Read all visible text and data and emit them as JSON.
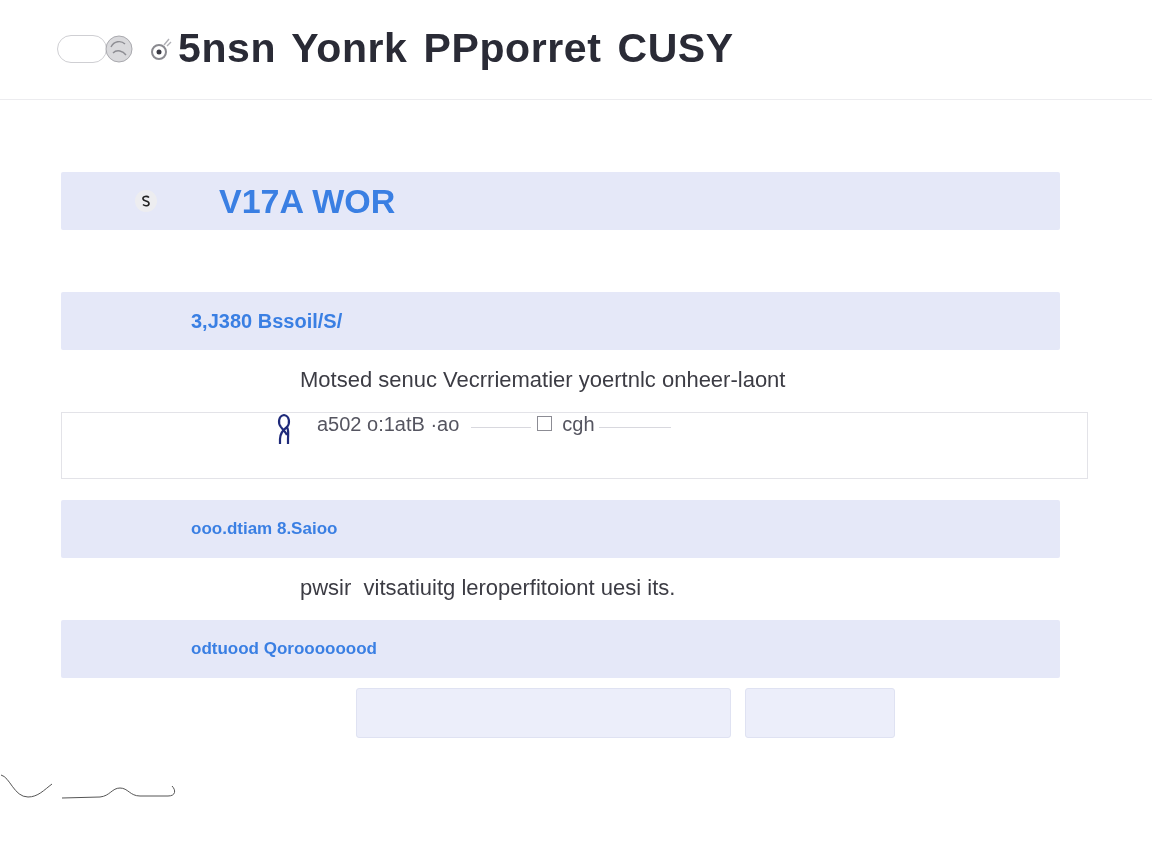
{
  "header": {
    "title": "5nsn Yonrk PPporret CUSY"
  },
  "sections": [
    {
      "kind": "main",
      "title": "V17A WOR"
    },
    {
      "kind": "sub",
      "title": "3,J380 Bssoil/S/",
      "description": "Motsed senuc Vecrriematier yoertnlc onheer-laont",
      "field": {
        "value": "a502 o:1atB ·ao",
        "checkbox": {
          "checked": false,
          "label": "cgh"
        }
      }
    },
    {
      "kind": "sub",
      "title": "ooo.dtiam 8.Saioo",
      "description": "pwsir  vitsatiuitg leroperfitoiont uesi its."
    },
    {
      "kind": "sub",
      "title": "odtuood Qoroooooood"
    }
  ],
  "buttons": [
    {
      "kind": "wide"
    },
    {
      "kind": "narrow"
    }
  ]
}
